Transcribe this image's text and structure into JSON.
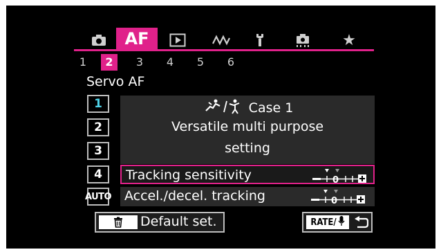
{
  "menu": {
    "tabs": [
      {
        "icon": "camera-icon"
      },
      {
        "label": "AF",
        "active": true
      },
      {
        "icon": "playback-icon"
      },
      {
        "icon": "wave-icon"
      },
      {
        "icon": "wrench-icon"
      },
      {
        "icon": "custom-function-icon"
      },
      {
        "icon": "star-icon"
      }
    ],
    "pages": [
      "1",
      "2",
      "3",
      "4",
      "5",
      "6"
    ],
    "active_page": "2",
    "accent_color": "#e0218a"
  },
  "section_title": "Servo AF",
  "cases": [
    {
      "label": "1",
      "selected": true
    },
    {
      "label": "2"
    },
    {
      "label": "3"
    },
    {
      "label": "4"
    },
    {
      "label": "AUTO"
    }
  ],
  "description": {
    "case_icon": "sports-tracking-icon",
    "case_title": "Case 1",
    "lines": [
      "Versatile multi purpose",
      "setting"
    ]
  },
  "settings": [
    {
      "label": "Tracking sensitivity",
      "icon": "sensitivity-scale-icon",
      "value": 0,
      "highlighted": true
    },
    {
      "label": "Accel./decel. tracking",
      "icon": "accel-scale-icon",
      "value": 0
    }
  ],
  "buttons": {
    "default": {
      "icon": "trash-icon",
      "label": "Default set."
    },
    "rate": {
      "key_label": "RATE/",
      "icon": "microphone-icon",
      "back_icon": "return-icon"
    }
  },
  "page_background": "#ffffff"
}
